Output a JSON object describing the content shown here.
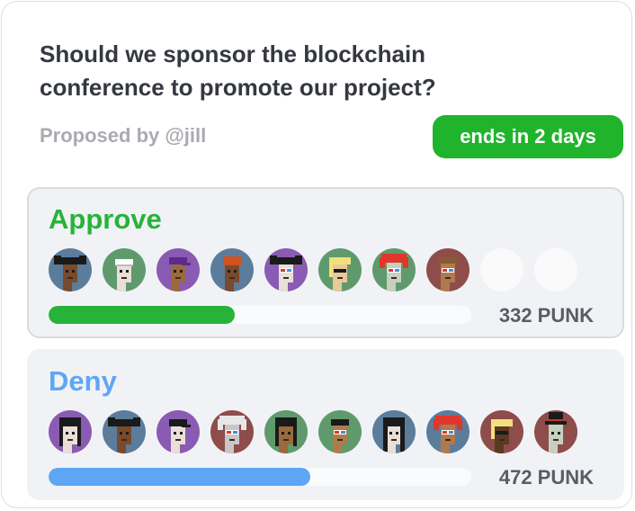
{
  "question": "Should we sponsor the blockchain conference to promote our project?",
  "proposer": "Proposed by @jill",
  "ends_badge": "ends in 2 days",
  "colors": {
    "approve": "#27b33a",
    "deny": "#5ea6f5",
    "badge": "#1fb42b"
  },
  "options": [
    {
      "label": "Approve",
      "value": "332 PUNK",
      "fill_percent": 44,
      "voters": [
        {
          "bg": "#5b7d9b",
          "skin": "#7a4a2c",
          "hair": "#1a1a1a",
          "style": "pigtails"
        },
        {
          "bg": "#5f9a6c",
          "skin": "#e9dfd6",
          "hair": "#ffffff",
          "style": "bandana"
        },
        {
          "bg": "#8a5bb2",
          "skin": "#9a6a3c",
          "hair": "#5e2a8c",
          "style": "cap"
        },
        {
          "bg": "#5b7d9b",
          "skin": "#7a4a2c",
          "hair": "#d0521e",
          "style": "beanie"
        },
        {
          "bg": "#8a5bb2",
          "skin": "#e9dfd6",
          "hair": "#1a1a1a",
          "style": "pigtails3d"
        },
        {
          "bg": "#5f9a6c",
          "skin": "#e7c99a",
          "hair": "#f4e07a",
          "style": "blonde"
        },
        {
          "bg": "#5f9a6c",
          "skin": "#c6d0c0",
          "hair": "#e0362b",
          "style": "wild"
        },
        {
          "bg": "#8e4d4a",
          "skin": "#b07a4c",
          "hair": "#8a5a35",
          "style": "3d"
        },
        {
          "empty": true
        },
        {
          "empty": true
        }
      ]
    },
    {
      "label": "Deny",
      "value": "472 PUNK",
      "fill_percent": 62,
      "voters": [
        {
          "bg": "#8a5bb2",
          "skin": "#e9dfd6",
          "hair": "#1a1a1a",
          "style": "hood"
        },
        {
          "bg": "#5b7d9b",
          "skin": "#7a4a2c",
          "hair": "#1a1a1a",
          "style": "pigtails"
        },
        {
          "bg": "#8a5bb2",
          "skin": "#e9dfd6",
          "hair": "#1a1a1a",
          "style": "cap"
        },
        {
          "bg": "#8e4d4a",
          "skin": "#c7c7c7",
          "hair": "#e8e8e8",
          "style": "wild"
        },
        {
          "bg": "#5f9a6c",
          "skin": "#9a6a3c",
          "hair": "#1a1a1a",
          "style": "hood"
        },
        {
          "bg": "#5f9a6c",
          "skin": "#b07a4c",
          "hair": "#1a1a1a",
          "style": "3d"
        },
        {
          "bg": "#5b7d9b",
          "skin": "#e9dfd6",
          "hair": "#1a1a1a",
          "style": "long"
        },
        {
          "bg": "#5b7d9b",
          "skin": "#b07a4c",
          "hair": "#e0362b",
          "style": "wild"
        },
        {
          "bg": "#8e4d4a",
          "skin": "#5a3a22",
          "hair": "#f4e07a",
          "style": "blonde"
        },
        {
          "bg": "#8e4d4a",
          "skin": "#c6d0c0",
          "hair": "#1a1a1a",
          "style": "tophat"
        }
      ]
    }
  ]
}
